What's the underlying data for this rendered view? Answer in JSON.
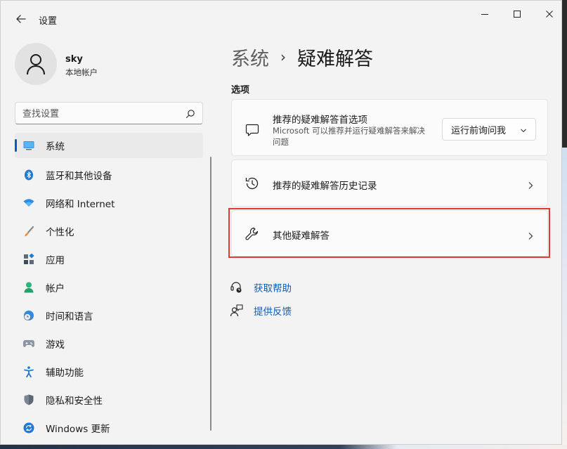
{
  "window": {
    "app_title": "设置",
    "back_icon": "back-arrow-icon",
    "controls": [
      "minimize-icon",
      "maximize-icon",
      "close-icon"
    ]
  },
  "profile": {
    "name": "sky",
    "account_type": "本地帐户"
  },
  "search": {
    "placeholder": "查找设置"
  },
  "sidebar": {
    "items": [
      {
        "label": "系统",
        "icon": "system-icon",
        "active": true
      },
      {
        "label": "蓝牙和其他设备",
        "icon": "bluetooth-icon"
      },
      {
        "label": "网络和 Internet",
        "icon": "network-icon"
      },
      {
        "label": "个性化",
        "icon": "personalization-icon"
      },
      {
        "label": "应用",
        "icon": "apps-icon"
      },
      {
        "label": "帐户",
        "icon": "accounts-icon"
      },
      {
        "label": "时间和语言",
        "icon": "time-language-icon"
      },
      {
        "label": "游戏",
        "icon": "gaming-icon"
      },
      {
        "label": "辅助功能",
        "icon": "accessibility-icon"
      },
      {
        "label": "隐私和安全性",
        "icon": "privacy-shield-icon"
      },
      {
        "label": "Windows 更新",
        "icon": "windows-update-icon"
      }
    ]
  },
  "main": {
    "breadcrumb_parent": "系统",
    "breadcrumb_separator": "›",
    "page_title": "疑难解答",
    "section_label": "选项",
    "cards": {
      "preferences": {
        "title": "推荐的疑难解答首选项",
        "description": "Microsoft 可以推荐并运行疑难解答来解决问题",
        "icon": "chat-bubble-icon",
        "dropdown_value": "运行前询问我"
      },
      "history": {
        "title": "推荐的疑难解答历史记录",
        "icon": "history-icon"
      },
      "other": {
        "title": "其他疑难解答",
        "icon": "wrench-icon"
      }
    },
    "links": {
      "help": "获取帮助",
      "feedback": "提供反馈"
    }
  },
  "colors": {
    "accent": "#005fb8",
    "highlight_border": "#e03a3a",
    "link": "#0b5db8"
  }
}
